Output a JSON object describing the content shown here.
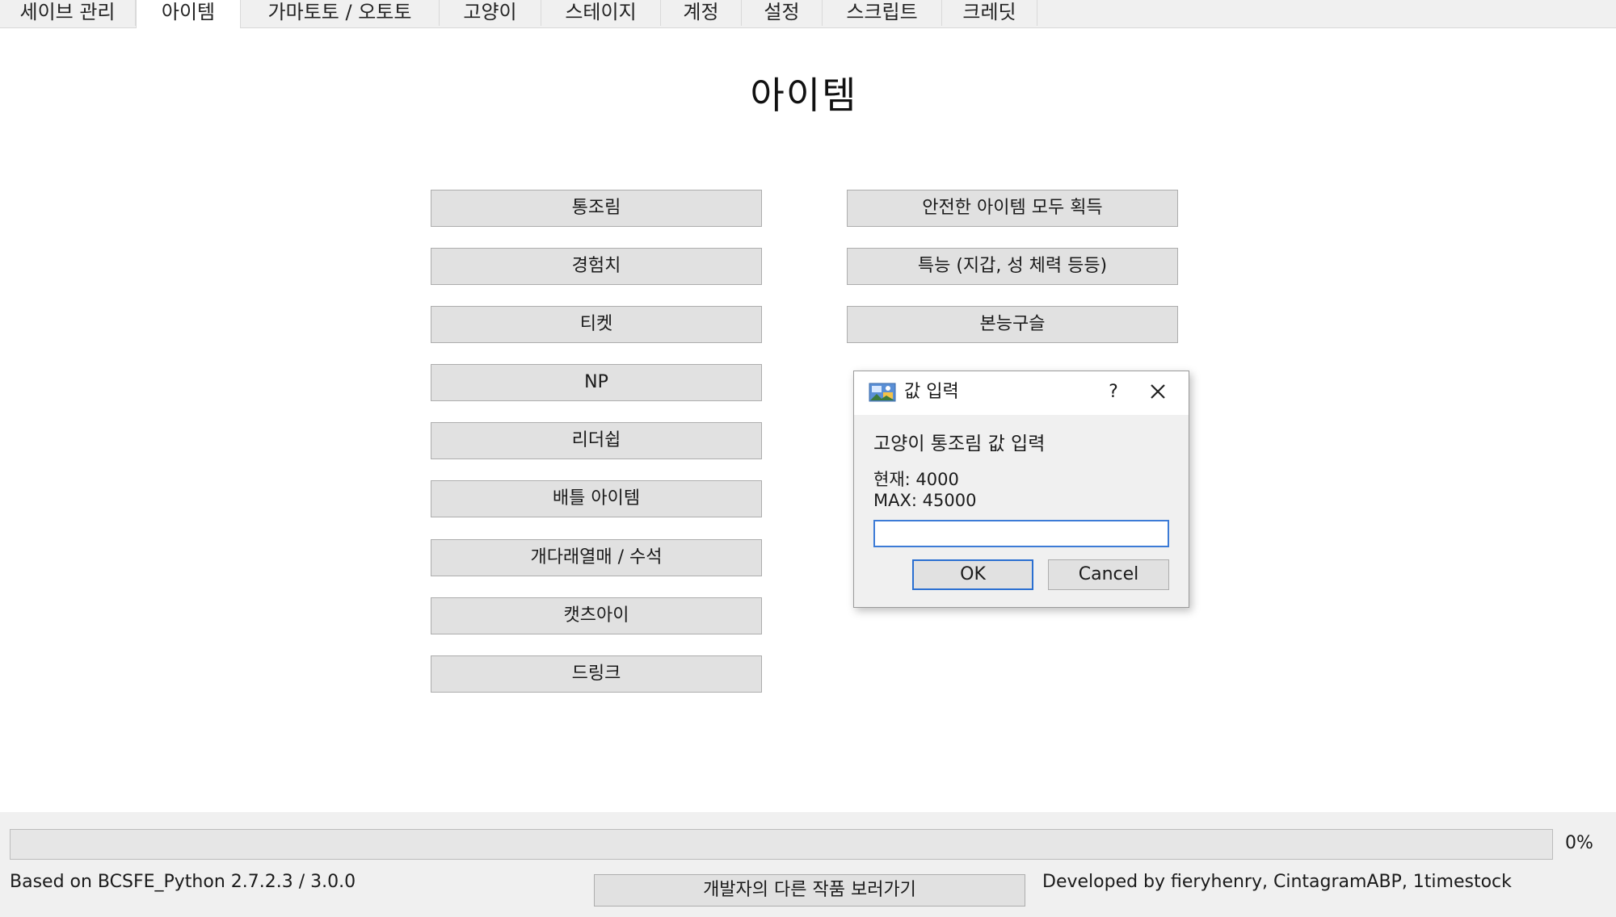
{
  "tabs": [
    {
      "label": "세이브 관리"
    },
    {
      "label": "아이템"
    },
    {
      "label": "가마토토 / 오토토"
    },
    {
      "label": "고양이"
    },
    {
      "label": "스테이지"
    },
    {
      "label": "계정"
    },
    {
      "label": "설정"
    },
    {
      "label": "스크립트"
    },
    {
      "label": "크레딧"
    }
  ],
  "active_tab": "아이템",
  "page_title": "아이템",
  "left_buttons": [
    {
      "label": "통조림"
    },
    {
      "label": "경험치"
    },
    {
      "label": "티켓"
    },
    {
      "label": "NP"
    },
    {
      "label": "리더쉽"
    },
    {
      "label": "배틀 아이템"
    },
    {
      "label": "개다래열매 / 수석"
    },
    {
      "label": "캣츠아이"
    },
    {
      "label": "드링크"
    }
  ],
  "right_buttons": [
    {
      "label": "안전한 아이템 모두 획득"
    },
    {
      "label": "특능 (지갑, 성 체력 등등)"
    },
    {
      "label": "본능구슬"
    }
  ],
  "dialog": {
    "title": "값 입력",
    "help": "?",
    "prompt": "고양이 통조림 값 입력",
    "current": "현재: 4000",
    "max": "MAX: 45000",
    "input_value": "",
    "ok_label": "OK",
    "cancel_label": "Cancel"
  },
  "progress": {
    "value": 0,
    "text": "0%"
  },
  "footer": {
    "based_on": "Based on BCSFE_Python 2.7.2.3 / 3.0.0",
    "other_works_label": "개발자의 다른 작품 보러가기",
    "developed_by": "Developed by fieryhenry, CintagramABP, 1timestock"
  },
  "colors": {
    "window_bg": "#f0f0f0",
    "button_face": "#e1e1e1",
    "focus_border": "#2a6fd1",
    "progress_fill": "#06b025"
  }
}
